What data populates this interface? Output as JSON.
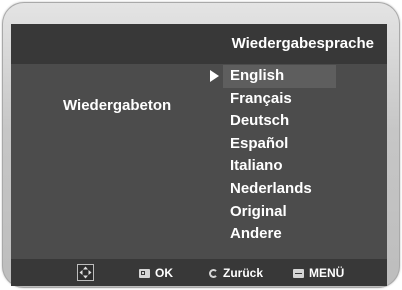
{
  "header": {
    "title": "Wiedergabesprache"
  },
  "setting": {
    "label": "Wiedergabeton"
  },
  "languages": {
    "selected_index": 0,
    "items": [
      "English",
      "Français",
      "Deutsch",
      "Español",
      "Italiano",
      "Nederlands",
      "Original",
      "Andere"
    ]
  },
  "footer": {
    "ok_label": "OK",
    "back_label": "Zurück",
    "menu_label": "MENÜ"
  },
  "colors": {
    "screen_bg": "#4c4c4c",
    "bar_bg": "#383838",
    "highlight_bg": "#5e5e5e",
    "text": "#ffffff"
  }
}
